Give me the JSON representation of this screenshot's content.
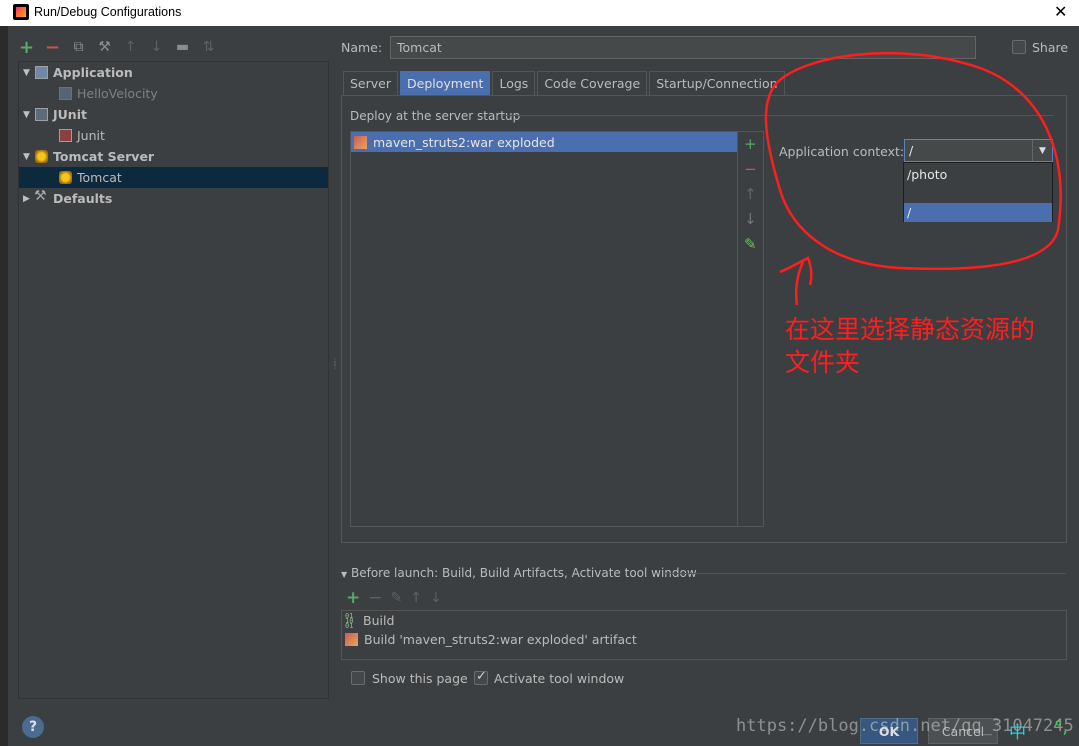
{
  "window": {
    "title": "Run/Debug Configurations"
  },
  "left_toolbar": {
    "icons": [
      "add-icon",
      "remove-icon",
      "copy-icon",
      "settings-wrench-icon",
      "move-up-icon",
      "move-down-icon",
      "folder-icon",
      "sort-icon"
    ]
  },
  "tree": {
    "items": [
      {
        "label": "Application"
      },
      {
        "label": "HelloVelocity"
      },
      {
        "label": "JUnit"
      },
      {
        "label": "Junit"
      },
      {
        "label": "Tomcat Server"
      },
      {
        "label": "Tomcat"
      },
      {
        "label": "Defaults"
      }
    ]
  },
  "config": {
    "name_label": "Name:",
    "name_value": "Tomcat",
    "share_label": "Share",
    "tabs": [
      {
        "label": "Server"
      },
      {
        "label": "Deployment"
      },
      {
        "label": "Logs"
      },
      {
        "label": "Code Coverage"
      },
      {
        "label": "Startup/Connection"
      }
    ],
    "active_tab": "Deployment"
  },
  "deployment": {
    "section_title": "Deploy at the server startup",
    "artifacts": [
      {
        "label": "maven_struts2:war exploded"
      }
    ],
    "context_label": "Application context:",
    "context_value": "/",
    "context_options": [
      {
        "label": "/photo"
      },
      {
        "label": ""
      },
      {
        "label": "/"
      }
    ]
  },
  "annotation": {
    "text_line1": "在这里选择静态资源的",
    "text_line2": "文件夹",
    "color": "#ff1e1e"
  },
  "before_launch": {
    "title": "Before launch: Build, Build Artifacts, Activate tool window",
    "items": [
      {
        "label": "Build"
      },
      {
        "label": "Build 'maven_struts2:war exploded' artifact"
      }
    ]
  },
  "options": {
    "show_page_label": "Show this page",
    "show_page_checked": false,
    "activate_label": "Activate tool window",
    "activate_checked": true
  },
  "footer": {
    "help": "?",
    "ok_label": "OK",
    "cancel_label": "Cancel",
    "watermark": "https://blog.csdn.net/qq_31047245",
    "ime_char": "中",
    "ime_punct": "°,"
  },
  "colors": {
    "background": "#3c3f41",
    "selection": "#4b6eaf",
    "tree_selection": "#0d293e",
    "accent_green": "#59a869",
    "accent_red": "#c75450"
  }
}
